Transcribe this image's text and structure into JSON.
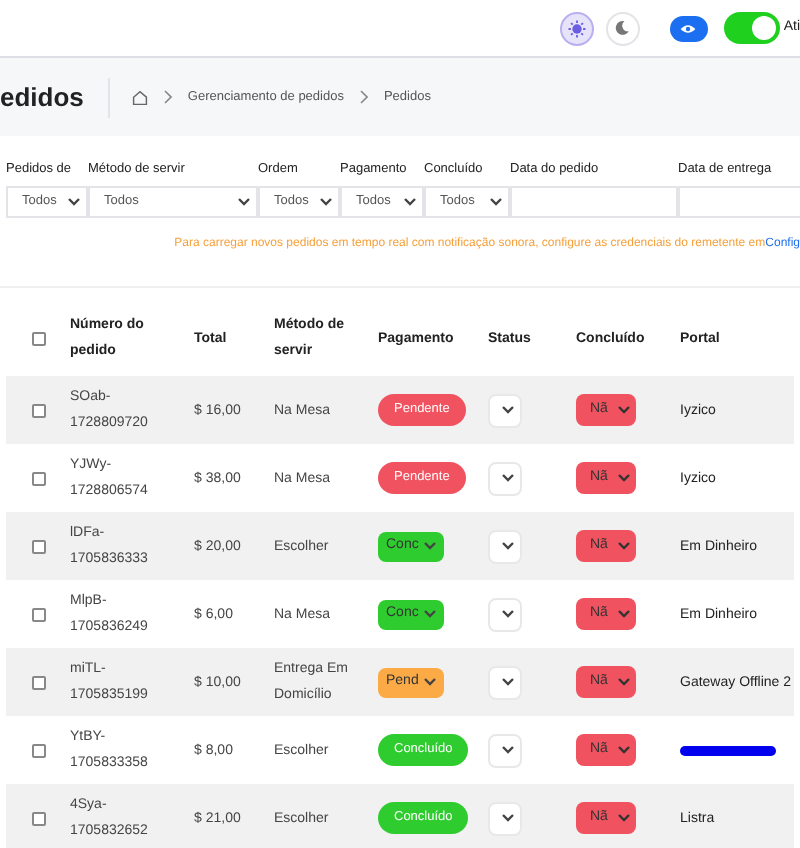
{
  "topbar": {
    "toggle_on": true,
    "toggle_label": "Ati"
  },
  "header": {
    "title": "edidos",
    "breadcrumbs": [
      "Gerenciamento de pedidos",
      "Pedidos"
    ]
  },
  "filters": [
    {
      "label": "Pedidos de",
      "kind": "select",
      "value": "Todos"
    },
    {
      "label": "Método de servir",
      "kind": "select",
      "value": "Todos"
    },
    {
      "label": "Ordem",
      "kind": "select",
      "value": "Todos"
    },
    {
      "label": "Pagamento",
      "kind": "select",
      "value": "Todos"
    },
    {
      "label": "Concluído",
      "kind": "select",
      "value": "Todos"
    },
    {
      "label": "Data do pedido",
      "kind": "date"
    },
    {
      "label": "Data de entrega",
      "kind": "date"
    }
  ],
  "notice": {
    "text": "Para carregar novos pedidos em tempo real com notificação sonora, configure as credenciais do remetente em ",
    "link": "Config"
  },
  "table": {
    "all_checked": false,
    "columns": [
      "Número do pedido",
      "Total",
      "Método de servir",
      "Pagamento",
      "Status",
      "Concluído",
      "Portal"
    ],
    "rows": [
      {
        "checked": false,
        "number": "SOab-1728809720",
        "total": "$ 16,00",
        "method": "Na Mesa",
        "payment": {
          "kind": "badge",
          "label": "Pendente",
          "color": "#f0525f"
        },
        "done": "Nã",
        "portal": {
          "kind": "text",
          "label": "Iyzico"
        }
      },
      {
        "checked": false,
        "number": "YJWy-1728806574",
        "total": "$ 38,00",
        "method": "Na Mesa",
        "payment": {
          "kind": "badge",
          "label": "Pendente",
          "color": "#f0525f"
        },
        "done": "Nã",
        "portal": {
          "kind": "text",
          "label": "Iyzico"
        }
      },
      {
        "checked": false,
        "number": "lDFa-1705836333",
        "total": "$ 20,00",
        "method": "Escolher",
        "payment": {
          "kind": "select",
          "label": "Conc",
          "color": "#2fcc2f"
        },
        "done": "Nã",
        "portal": {
          "kind": "text",
          "label": "Em Dinheiro"
        }
      },
      {
        "checked": false,
        "number": "MlpB-1705836249",
        "total": "$ 6,00",
        "method": "Na Mesa",
        "payment": {
          "kind": "select",
          "label": "Conc",
          "color": "#2fcc2f"
        },
        "done": "Nã",
        "portal": {
          "kind": "text",
          "label": "Em Dinheiro"
        }
      },
      {
        "checked": false,
        "number": "miTL-1705835199",
        "total": "$ 10,00",
        "method": "Entrega Em Domicílio",
        "payment": {
          "kind": "select",
          "label": "Pend",
          "color": "#fbaa45"
        },
        "done": "Nã",
        "portal": {
          "kind": "text",
          "label": "Gateway Offline 2"
        }
      },
      {
        "checked": false,
        "number": "YtBY-1705833358",
        "total": "$ 8,00",
        "method": "Escolher",
        "payment": {
          "kind": "badge",
          "label": "Concluído",
          "color": "#2fcc2f"
        },
        "done": "Nã",
        "portal": {
          "kind": "redacted"
        }
      },
      {
        "checked": false,
        "number": "4Sya-1705832652",
        "total": "$ 21,00",
        "method": "Escolher",
        "payment": {
          "kind": "badge",
          "label": "Concluído",
          "color": "#2fcc2f"
        },
        "done": "Nã",
        "portal": {
          "kind": "text",
          "label": "Listra"
        }
      }
    ]
  }
}
